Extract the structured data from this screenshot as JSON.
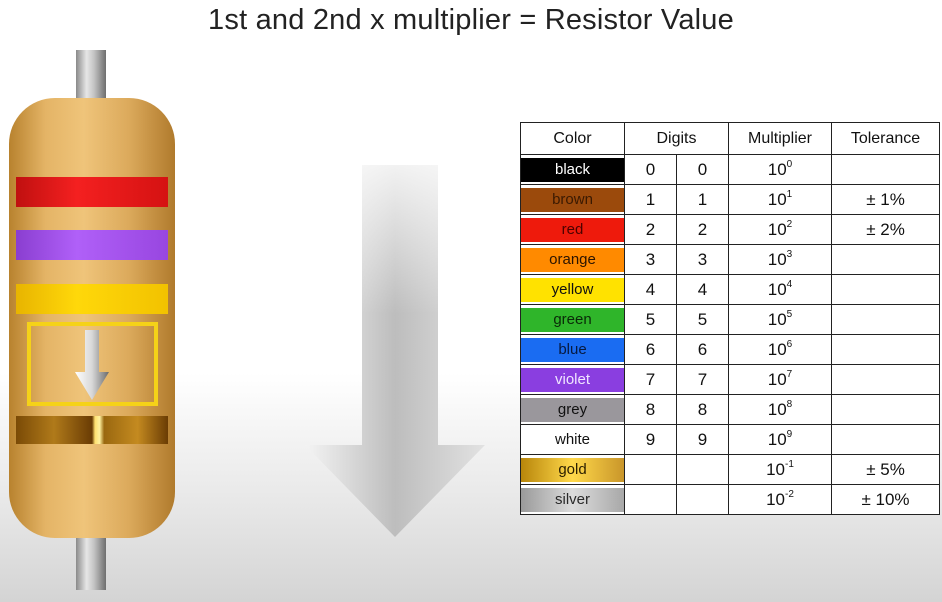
{
  "title": "1st and 2nd x multiplier = Resistor Value",
  "table": {
    "headers": {
      "color": "Color",
      "digits": "Digits",
      "multiplier": "Multiplier",
      "tolerance": "Tolerance"
    },
    "rows": [
      {
        "color": "black",
        "hex": "#000000",
        "text": "#ffffff",
        "d1": "0",
        "d2": "0",
        "base": "10",
        "exp": "0",
        "tol": ""
      },
      {
        "color": "brown",
        "hex": "#9b4a0c",
        "text": "#3a1a02",
        "d1": "1",
        "d2": "1",
        "base": "10",
        "exp": "1",
        "tol": "± 1%"
      },
      {
        "color": "red",
        "hex": "#ee1a0c",
        "text": "#4a0200",
        "d1": "2",
        "d2": "2",
        "base": "10",
        "exp": "2",
        "tol": "± 2%"
      },
      {
        "color": "orange",
        "hex": "#ff8a00",
        "text": "#2a1400",
        "d1": "3",
        "d2": "3",
        "base": "10",
        "exp": "3",
        "tol": ""
      },
      {
        "color": "yellow",
        "hex": "#ffe200",
        "text": "#111111",
        "d1": "4",
        "d2": "4",
        "base": "10",
        "exp": "4",
        "tol": ""
      },
      {
        "color": "green",
        "hex": "#2fb52a",
        "text": "#0a2a08",
        "d1": "5",
        "d2": "5",
        "base": "10",
        "exp": "5",
        "tol": ""
      },
      {
        "color": "blue",
        "hex": "#1a6cf2",
        "text": "#071a40",
        "d1": "6",
        "d2": "6",
        "base": "10",
        "exp": "6",
        "tol": ""
      },
      {
        "color": "violet",
        "hex": "#8a3ee0",
        "text": "#f0e6ff",
        "d1": "7",
        "d2": "7",
        "base": "10",
        "exp": "7",
        "tol": ""
      },
      {
        "color": "grey",
        "hex": "#9a979c",
        "text": "#111111",
        "d1": "8",
        "d2": "8",
        "base": "10",
        "exp": "8",
        "tol": ""
      },
      {
        "color": "white",
        "hex": "#ffffff",
        "text": "#111111",
        "d1": "9",
        "d2": "9",
        "base": "10",
        "exp": "9",
        "tol": ""
      },
      {
        "color": "gold",
        "hex": "#d8b030",
        "text": "#2a1e00",
        "d1": "",
        "d2": "",
        "base": "10",
        "exp": "-1",
        "tol": "± 5%"
      },
      {
        "color": "silver",
        "hex": "#bcbcbc",
        "text": "#2a2a2a",
        "d1": "",
        "d2": "",
        "base": "10",
        "exp": "-2",
        "tol": "± 10%"
      }
    ]
  },
  "resistor_bands": [
    "red",
    "violet",
    "yellow",
    "gold"
  ]
}
